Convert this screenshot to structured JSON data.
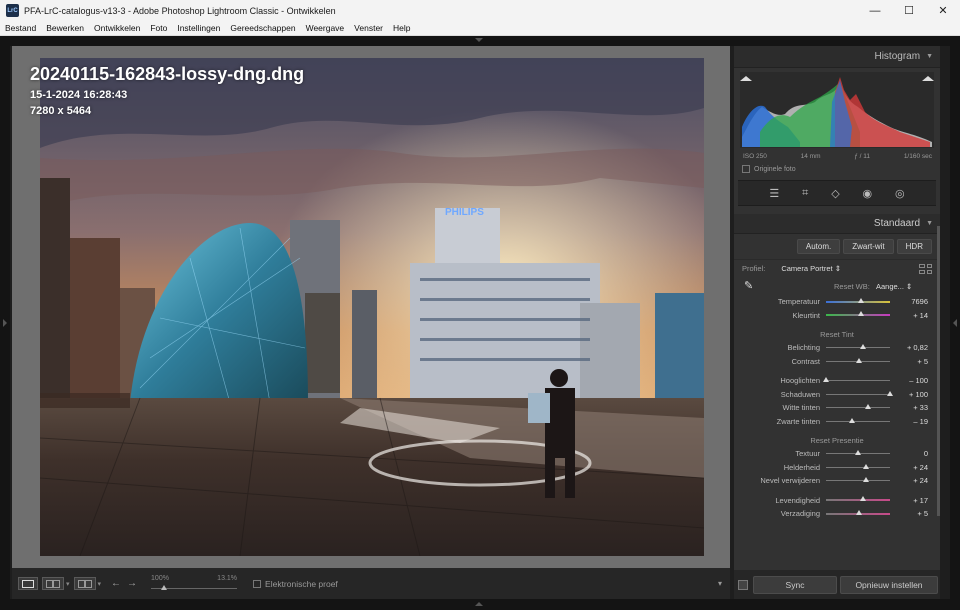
{
  "window": {
    "app_icon": "LrC",
    "title": "PFA-LrC-catalogus-v13-3 - Adobe Photoshop Lightroom Classic - Ontwikkelen",
    "minimize": "—",
    "maximize": "☐",
    "close": "✕"
  },
  "menu": [
    "Bestand",
    "Bewerken",
    "Ontwikkelen",
    "Foto",
    "Instellingen",
    "Gereedschappen",
    "Weergave",
    "Venster",
    "Help"
  ],
  "photo_info": {
    "filename": "20240115-162843-lossy-dng.dng",
    "datetime": "15-1-2024 16:28:43",
    "dimensions": "7280 x 5464"
  },
  "toolbar": {
    "zoom_left": "100%",
    "zoom_right": "13.1%",
    "softproof_label": "Elektronische proef",
    "prev_icon": "←",
    "next_icon": "→"
  },
  "histogram": {
    "title": "Histogram",
    "iso": "ISO 250",
    "focal": "14 mm",
    "aperture": "ƒ / 11",
    "shutter": "1/160 sec",
    "original_photo": "Originele foto"
  },
  "basic": {
    "title": "Standaard",
    "btn_auto": "Autom.",
    "btn_bw": "Zwart-wit",
    "btn_hdr": "HDR",
    "profile_label": "Profiel:",
    "profile_value": "Camera Portret ⇕",
    "wb_label": "Reset WB:",
    "wb_value": "Aange... ⇕",
    "tone_header": "Reset Tint",
    "presence_header": "Reset Presentie",
    "sliders_wb": [
      {
        "label": "Temperatuur",
        "value": "7696",
        "pos": 0.55
      },
      {
        "label": "Kleurtint",
        "value": "+ 14",
        "pos": 0.55
      }
    ],
    "sliders_tone": [
      {
        "label": "Belichting",
        "value": "+ 0,82",
        "pos": 0.58
      },
      {
        "label": "Contrast",
        "value": "+ 5",
        "pos": 0.52
      }
    ],
    "sliders_tone2": [
      {
        "label": "Hooglichten",
        "value": "– 100",
        "pos": 0.0
      },
      {
        "label": "Schaduwen",
        "value": "+ 100",
        "pos": 1.0
      },
      {
        "label": "Witte tinten",
        "value": "+ 33",
        "pos": 0.66
      },
      {
        "label": "Zwarte tinten",
        "value": "– 19",
        "pos": 0.41
      }
    ],
    "sliders_presence": [
      {
        "label": "Textuur",
        "value": "0",
        "pos": 0.5
      },
      {
        "label": "Helderheid",
        "value": "+ 24",
        "pos": 0.62
      },
      {
        "label": "Nevel verwijderen",
        "value": "+ 24",
        "pos": 0.62
      }
    ],
    "sliders_presence2": [
      {
        "label": "Levendigheid",
        "value": "+ 17",
        "pos": 0.58
      },
      {
        "label": "Verzadiging",
        "value": "+ 5",
        "pos": 0.52
      }
    ]
  },
  "bottom": {
    "sync": "Sync",
    "reset": "Opnieuw instellen"
  }
}
